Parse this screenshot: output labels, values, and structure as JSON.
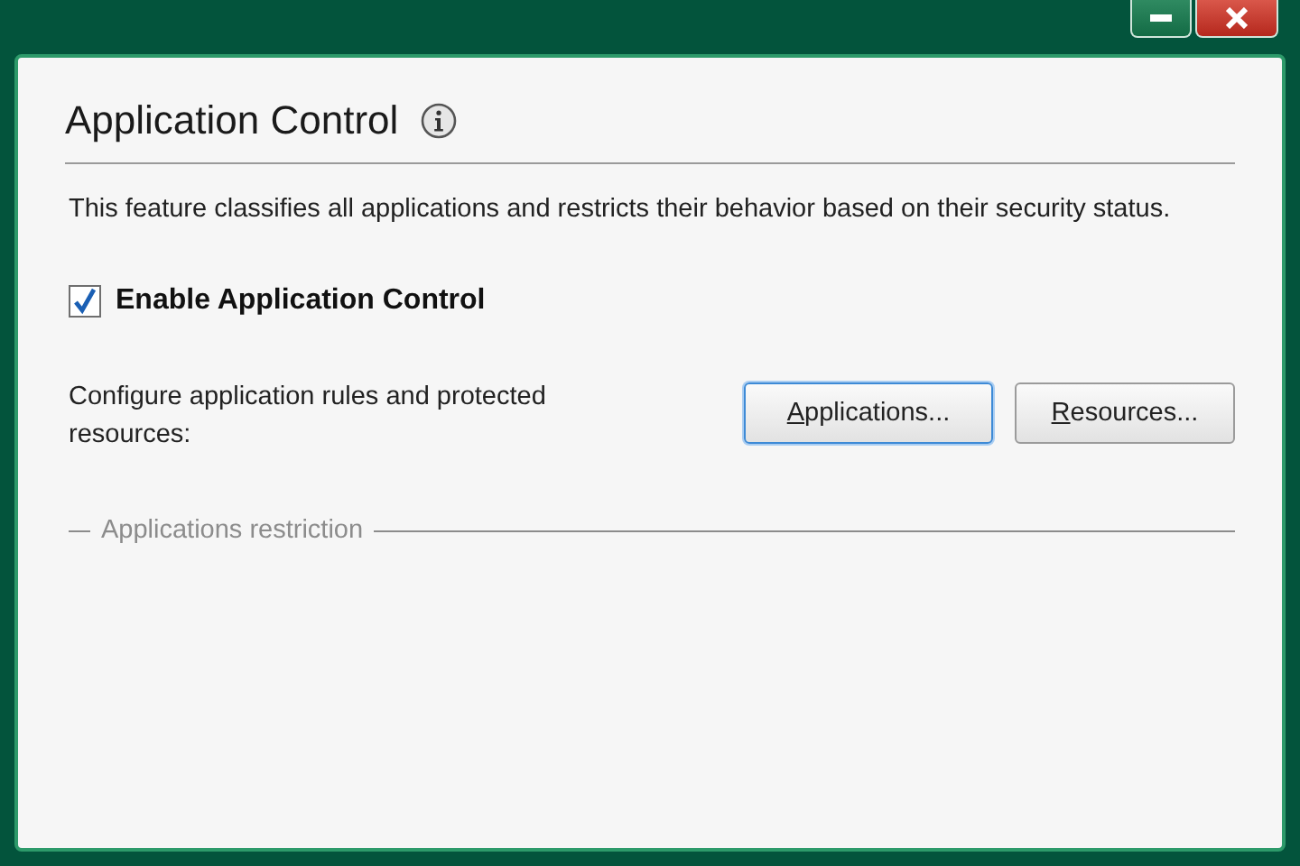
{
  "window": {
    "controls": [
      {
        "kind": "minimize"
      },
      {
        "kind": "close"
      }
    ]
  },
  "header": {
    "title": "Application Control"
  },
  "description": "This feature classifies all applications and restricts their behavior based on their security status.",
  "enable_checkbox": {
    "label": "Enable Application Control",
    "checked": true
  },
  "configure": {
    "text": "Configure application rules and protected resources:",
    "buttons": [
      {
        "mnemonic": "A",
        "label_rest": "pplications...",
        "focused": true
      },
      {
        "mnemonic": "R",
        "label_rest": "esources...",
        "focused": false
      }
    ]
  },
  "group": {
    "title": "Applications restriction",
    "disabled": true
  }
}
